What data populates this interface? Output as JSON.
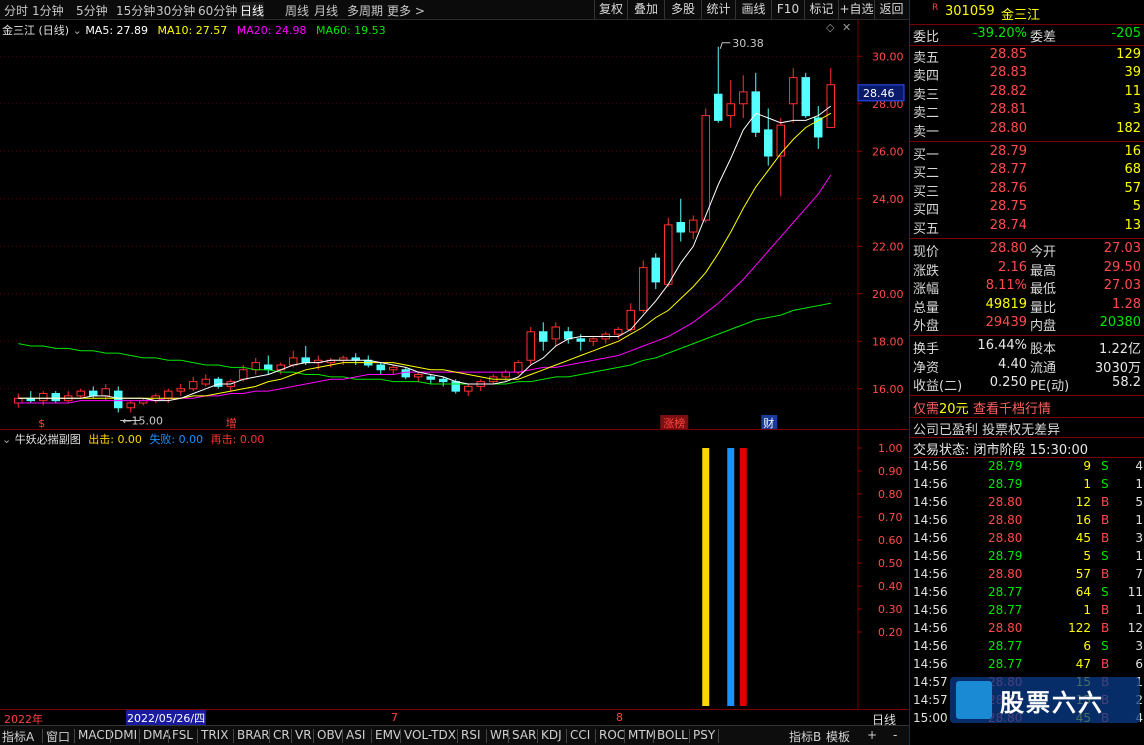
{
  "stock": {
    "code": "301059",
    "name": "金三江",
    "name_chart": "金三江 (日线)",
    "mark": "R"
  },
  "toolbar": {
    "timeframes": [
      "分时",
      "1分钟",
      "5分钟",
      "15分钟",
      "30分钟",
      "60分钟",
      "日线",
      "周线",
      "月线",
      "多周期",
      "更多 >"
    ],
    "active_timeframe": "日线",
    "buttons": [
      "复权",
      "叠加",
      "多股",
      "统计",
      "画线",
      "F10",
      "标记",
      "+自选",
      "返回"
    ]
  },
  "ma_legend": {
    "ma5": "MA5: 27.89",
    "ma10": "MA10: 27.57",
    "ma20": "MA20: 24.98",
    "ma60": "MA60: 19.53",
    "colors": {
      "ma5": "#ffffff",
      "ma10": "#ffff00",
      "ma20": "#ff00ff",
      "ma60": "#00e600"
    }
  },
  "chart_data": [
    {
      "type": "candlestick",
      "title": "金三江 (日线)",
      "ylim": [
        14.6,
        30.6
      ],
      "yticks": [
        "30.00",
        "28.00",
        "26.00",
        "24.00",
        "22.00",
        "20.00",
        "18.00",
        "16.00"
      ],
      "current_price_label": "28.46",
      "high_annotation": "30.38",
      "low_annotation": "15.00",
      "markers": [
        {
          "label": "$",
          "index": 2
        },
        {
          "label": "增",
          "index": 17
        },
        {
          "label": "涨榜",
          "index": 52
        },
        {
          "label": "财",
          "index": 60
        }
      ],
      "ohlc": [
        [
          15.4,
          15.8,
          15.2,
          15.6
        ],
        [
          15.6,
          15.9,
          15.4,
          15.5
        ],
        [
          15.5,
          15.9,
          15.3,
          15.8
        ],
        [
          15.8,
          15.9,
          15.4,
          15.5
        ],
        [
          15.5,
          15.9,
          15.4,
          15.7
        ],
        [
          15.7,
          16.0,
          15.6,
          15.9
        ],
        [
          15.9,
          16.1,
          15.6,
          15.7
        ],
        [
          15.7,
          16.2,
          15.5,
          16.0
        ],
        [
          15.9,
          16.1,
          15.0,
          15.2
        ],
        [
          15.2,
          15.5,
          15.0,
          15.4
        ],
        [
          15.4,
          15.6,
          15.3,
          15.5
        ],
        [
          15.5,
          15.8,
          15.4,
          15.7
        ],
        [
          15.6,
          16.0,
          15.4,
          15.9
        ],
        [
          15.9,
          16.2,
          15.7,
          16.0
        ],
        [
          16.0,
          16.5,
          15.9,
          16.3
        ],
        [
          16.2,
          16.6,
          16.1,
          16.4
        ],
        [
          16.4,
          16.5,
          16.0,
          16.1
        ],
        [
          16.1,
          16.4,
          15.9,
          16.3
        ],
        [
          16.4,
          17.0,
          16.3,
          16.8
        ],
        [
          16.8,
          17.3,
          16.6,
          17.1
        ],
        [
          17.0,
          17.4,
          16.6,
          16.8
        ],
        [
          16.8,
          17.1,
          16.6,
          17.0
        ],
        [
          17.0,
          17.6,
          16.9,
          17.3
        ],
        [
          17.3,
          17.8,
          17.0,
          17.1
        ],
        [
          17.1,
          17.4,
          16.8,
          17.2
        ],
        [
          17.1,
          17.3,
          16.9,
          17.2
        ],
        [
          17.2,
          17.4,
          17.0,
          17.3
        ],
        [
          17.3,
          17.5,
          17.0,
          17.2
        ],
        [
          17.2,
          17.4,
          16.9,
          17.0
        ],
        [
          17.0,
          17.1,
          16.6,
          16.8
        ],
        [
          16.8,
          17.0,
          16.6,
          16.9
        ],
        [
          16.8,
          16.9,
          16.4,
          16.5
        ],
        [
          16.5,
          16.7,
          16.3,
          16.6
        ],
        [
          16.5,
          16.6,
          16.2,
          16.4
        ],
        [
          16.4,
          16.5,
          16.1,
          16.3
        ],
        [
          16.3,
          16.4,
          15.8,
          15.9
        ],
        [
          15.9,
          16.2,
          15.7,
          16.1
        ],
        [
          16.1,
          16.4,
          15.9,
          16.3
        ],
        [
          16.3,
          16.6,
          16.2,
          16.5
        ],
        [
          16.5,
          16.8,
          16.3,
          16.7
        ],
        [
          16.7,
          17.2,
          16.6,
          17.1
        ],
        [
          17.2,
          18.6,
          17.0,
          18.4
        ],
        [
          18.4,
          18.8,
          17.6,
          18.0
        ],
        [
          18.1,
          18.8,
          17.8,
          18.6
        ],
        [
          18.4,
          18.6,
          17.9,
          18.1
        ],
        [
          18.1,
          18.3,
          17.6,
          18.0
        ],
        [
          18.0,
          18.2,
          17.8,
          18.1
        ],
        [
          18.1,
          18.4,
          17.9,
          18.3
        ],
        [
          18.3,
          18.6,
          18.1,
          18.5
        ],
        [
          18.5,
          19.6,
          18.4,
          19.3
        ],
        [
          19.3,
          21.4,
          19.2,
          21.1
        ],
        [
          21.5,
          21.7,
          20.2,
          20.5
        ],
        [
          20.4,
          23.2,
          20.3,
          22.9
        ],
        [
          23.0,
          24.0,
          22.2,
          22.6
        ],
        [
          22.6,
          23.3,
          22.3,
          23.1
        ],
        [
          23.1,
          27.8,
          23.0,
          27.5
        ],
        [
          28.4,
          30.4,
          27.2,
          27.3
        ],
        [
          27.5,
          29.0,
          27.0,
          28.0
        ],
        [
          28.0,
          29.2,
          27.4,
          28.5
        ],
        [
          28.5,
          29.3,
          26.6,
          26.8
        ],
        [
          26.9,
          27.8,
          25.4,
          25.8
        ],
        [
          25.8,
          27.4,
          24.1,
          27.1
        ],
        [
          28.0,
          29.5,
          27.2,
          29.1
        ],
        [
          29.1,
          29.3,
          27.4,
          27.5
        ],
        [
          27.4,
          27.9,
          26.1,
          26.6
        ],
        [
          27.0,
          29.5,
          27.0,
          28.8
        ]
      ],
      "ma": {
        "ma5": [
          15.6,
          15.6,
          15.6,
          15.6,
          15.6,
          15.6,
          15.7,
          15.7,
          15.6,
          15.6,
          15.6,
          15.5,
          15.5,
          15.6,
          15.8,
          16.0,
          16.2,
          16.2,
          16.4,
          16.5,
          16.6,
          16.8,
          17.0,
          17.1,
          17.1,
          17.2,
          17.2,
          17.2,
          17.2,
          17.1,
          17.0,
          16.9,
          16.7,
          16.6,
          16.5,
          16.3,
          16.2,
          16.2,
          16.2,
          16.3,
          16.5,
          17.0,
          17.3,
          17.8,
          18.1,
          18.2,
          18.2,
          18.2,
          18.2,
          18.5,
          19.1,
          19.7,
          20.4,
          21.3,
          22.0,
          23.3,
          24.6,
          25.7,
          26.9,
          27.6,
          27.4,
          27.2,
          27.3,
          27.3,
          27.5,
          27.9
        ],
        "ma10": [
          15.6,
          15.6,
          15.6,
          15.6,
          15.6,
          15.6,
          15.6,
          15.6,
          15.6,
          15.6,
          15.6,
          15.6,
          15.6,
          15.6,
          15.7,
          15.7,
          15.8,
          15.9,
          16.0,
          16.1,
          16.3,
          16.4,
          16.6,
          16.8,
          16.9,
          17.0,
          17.1,
          17.1,
          17.1,
          17.1,
          17.1,
          17.0,
          16.9,
          16.8,
          16.8,
          16.7,
          16.6,
          16.5,
          16.4,
          16.4,
          16.4,
          16.6,
          16.8,
          17.0,
          17.2,
          17.4,
          17.6,
          17.8,
          18.0,
          18.3,
          18.6,
          19.0,
          19.3,
          19.8,
          20.3,
          20.9,
          21.7,
          22.6,
          23.6,
          24.5,
          25.2,
          25.9,
          26.5,
          27.0,
          27.3,
          27.6
        ],
        "ma20": [
          15.4,
          15.4,
          15.4,
          15.4,
          15.4,
          15.5,
          15.5,
          15.5,
          15.5,
          15.5,
          15.5,
          15.5,
          15.6,
          15.6,
          15.6,
          15.7,
          15.7,
          15.8,
          15.8,
          15.9,
          15.9,
          16.0,
          16.1,
          16.2,
          16.3,
          16.4,
          16.4,
          16.5,
          16.6,
          16.6,
          16.6,
          16.7,
          16.7,
          16.7,
          16.7,
          16.7,
          16.7,
          16.7,
          16.7,
          16.7,
          16.7,
          16.8,
          16.9,
          16.9,
          17.0,
          17.1,
          17.2,
          17.3,
          17.4,
          17.6,
          17.8,
          18.0,
          18.2,
          18.5,
          18.8,
          19.2,
          19.6,
          20.1,
          20.6,
          21.2,
          21.8,
          22.4,
          23.0,
          23.6,
          24.2,
          25.0
        ],
        "ma60": [
          17.9,
          17.8,
          17.8,
          17.7,
          17.7,
          17.6,
          17.6,
          17.5,
          17.5,
          17.4,
          17.3,
          17.3,
          17.2,
          17.2,
          17.1,
          17.0,
          17.0,
          16.9,
          16.9,
          16.8,
          16.8,
          16.7,
          16.7,
          16.6,
          16.6,
          16.5,
          16.5,
          16.4,
          16.4,
          16.4,
          16.3,
          16.3,
          16.3,
          16.2,
          16.2,
          16.2,
          16.2,
          16.2,
          16.2,
          16.2,
          16.3,
          16.3,
          16.4,
          16.5,
          16.5,
          16.6,
          16.7,
          16.8,
          16.9,
          17.0,
          17.2,
          17.3,
          17.5,
          17.7,
          17.9,
          18.1,
          18.3,
          18.5,
          18.7,
          18.9,
          19.0,
          19.1,
          19.3,
          19.4,
          19.5,
          19.6
        ]
      }
    },
    {
      "type": "bar",
      "title": "牛妖必揣副图",
      "ylim": [
        0,
        1.0
      ],
      "yticks": [
        "1.00",
        "0.90",
        "0.80",
        "0.70",
        "0.60",
        "0.50",
        "0.40",
        "0.30",
        "0.20"
      ],
      "series": [
        {
          "name": "出击",
          "value_text": "0.00",
          "color": "#ffd700",
          "bars": [
            {
              "index": 55,
              "value": 1.0
            }
          ]
        },
        {
          "name": "失败",
          "value_text": "0.00",
          "color": "#1e90ff",
          "bars": [
            {
              "index": 57,
              "value": 1.0
            }
          ]
        },
        {
          "name": "再击",
          "value_text": "0.00",
          "color": "#e00000",
          "bars": [
            {
              "index": 58,
              "value": 1.0
            }
          ]
        }
      ]
    }
  ],
  "subchart": {
    "title": "牛妖必揣副图",
    "s1": "出击:",
    "v1": "0.00",
    "s2": "失败:",
    "v2": "0.00",
    "s3": "再击:",
    "v3": "0.00"
  },
  "axis": {
    "year": "2022年",
    "date_cursor": "2022/05/26/四",
    "month7": "7",
    "month8": "8",
    "period": "日线"
  },
  "tabs": [
    "指标A",
    "窗口",
    "MACD",
    "DMI",
    "DMA",
    "FSL",
    "TRIX",
    "BRAR",
    "CR",
    "VR",
    "OBV",
    "ASI",
    "EMV",
    "VOL-TDX",
    "RSI",
    "WR",
    "SAR",
    "KDJ",
    "CCI",
    "ROC",
    "MTM",
    "BOLL",
    "PSY"
  ],
  "tabs_right": [
    "指标B",
    "模板",
    "+",
    "-"
  ],
  "quote": {
    "weibi_label": "委比",
    "weibi": "-39.20%",
    "weicha_label": "委差",
    "weicha": "-205",
    "asks": [
      {
        "label": "卖五",
        "price": "28.85",
        "vol": "129"
      },
      {
        "label": "卖四",
        "price": "28.83",
        "vol": "39"
      },
      {
        "label": "卖三",
        "price": "28.82",
        "vol": "11"
      },
      {
        "label": "卖二",
        "price": "28.81",
        "vol": "3"
      },
      {
        "label": "卖一",
        "price": "28.80",
        "vol": "182"
      }
    ],
    "bids": [
      {
        "label": "买一",
        "price": "28.79",
        "vol": "16"
      },
      {
        "label": "买二",
        "price": "28.77",
        "vol": "68"
      },
      {
        "label": "买三",
        "price": "28.76",
        "vol": "57"
      },
      {
        "label": "买四",
        "price": "28.75",
        "vol": "5"
      },
      {
        "label": "买五",
        "price": "28.74",
        "vol": "13"
      }
    ],
    "stats": [
      {
        "l1": "现价",
        "v1": "28.80",
        "c1": "red",
        "l2": "今开",
        "v2": "27.03",
        "c2": "red"
      },
      {
        "l1": "涨跌",
        "v1": "2.16",
        "c1": "red",
        "l2": "最高",
        "v2": "29.50",
        "c2": "red"
      },
      {
        "l1": "涨幅",
        "v1": "8.11%",
        "c1": "red",
        "l2": "最低",
        "v2": "27.03",
        "c2": "red"
      },
      {
        "l1": "总量",
        "v1": "49819",
        "c1": "yellow",
        "l2": "量比",
        "v2": "1.28",
        "c2": "red"
      },
      {
        "l1": "外盘",
        "v1": "29439",
        "c1": "red",
        "l2": "内盘",
        "v2": "20380",
        "c2": "green"
      }
    ],
    "fund": [
      {
        "l1": "换手",
        "v1": "16.44%",
        "l2": "股本",
        "v2": "1.22亿"
      },
      {
        "l1": "净资",
        "v1": "4.40",
        "l2": "流通",
        "v2": "3030万"
      },
      {
        "l1": "收益(二)",
        "v1": "0.250",
        "l2": "PE(动)",
        "v2": "58.2"
      }
    ],
    "promo1_a": "仅需",
    "promo1_b": "20元",
    "promo1_c": "查看千档行情",
    "promo2": "公司已盈利 投票权无差异",
    "status": "交易状态: 闭市阶段 15:30:00"
  },
  "ticks": [
    {
      "t": "14:56",
      "p": "28.79",
      "pc": "green",
      "v": "9",
      "s": "S",
      "n": "4"
    },
    {
      "t": "14:56",
      "p": "28.79",
      "pc": "green",
      "v": "1",
      "s": "S",
      "n": "1"
    },
    {
      "t": "14:56",
      "p": "28.80",
      "pc": "red",
      "v": "12",
      "s": "B",
      "n": "5"
    },
    {
      "t": "14:56",
      "p": "28.80",
      "pc": "red",
      "v": "16",
      "s": "B",
      "n": "1"
    },
    {
      "t": "14:56",
      "p": "28.80",
      "pc": "red",
      "v": "45",
      "s": "B",
      "n": "3"
    },
    {
      "t": "14:56",
      "p": "28.79",
      "pc": "green",
      "v": "5",
      "s": "S",
      "n": "1"
    },
    {
      "t": "14:56",
      "p": "28.80",
      "pc": "red",
      "v": "57",
      "s": "B",
      "n": "7"
    },
    {
      "t": "14:56",
      "p": "28.77",
      "pc": "green",
      "v": "64",
      "s": "S",
      "n": "11"
    },
    {
      "t": "14:56",
      "p": "28.77",
      "pc": "green",
      "v": "1",
      "s": "B",
      "n": "1"
    },
    {
      "t": "14:56",
      "p": "28.80",
      "pc": "red",
      "v": "122",
      "s": "B",
      "n": "12"
    },
    {
      "t": "14:56",
      "p": "28.77",
      "pc": "green",
      "v": "6",
      "s": "S",
      "n": "3"
    },
    {
      "t": "14:56",
      "p": "28.77",
      "pc": "green",
      "v": "47",
      "s": "B",
      "n": "6"
    },
    {
      "t": "14:57",
      "p": "28.80",
      "pc": "red",
      "v": "15",
      "s": "B",
      "n": "1"
    },
    {
      "t": "14:57",
      "p": "28.80",
      "pc": "red",
      "v": "15",
      "s": "B",
      "n": "2"
    },
    {
      "t": "15:00",
      "p": "28.80",
      "pc": "red",
      "v": "45",
      "s": "B",
      "n": "4"
    }
  ],
  "watermark": "股票六六"
}
